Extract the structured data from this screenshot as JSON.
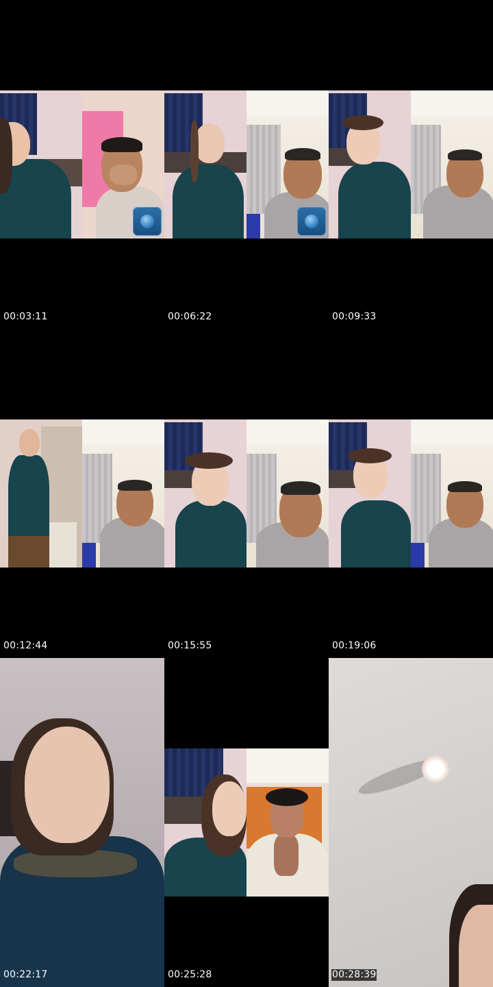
{
  "thumbnails": [
    {
      "timestamp": "00:03:11"
    },
    {
      "timestamp": "00:06:22"
    },
    {
      "timestamp": "00:09:33"
    },
    {
      "timestamp": "00:12:44"
    },
    {
      "timestamp": "00:15:55"
    },
    {
      "timestamp": "00:19:06"
    },
    {
      "timestamp": "00:22:17"
    },
    {
      "timestamp": "00:25:28"
    },
    {
      "timestamp": "00:28:39"
    }
  ],
  "colors": {
    "background": "#000000",
    "timestamp_text": "#ffffff",
    "dress_teal": "#17444d",
    "shirt_grey": "#a9a5a6"
  },
  "icons": [
    "video-call-app-icon"
  ]
}
